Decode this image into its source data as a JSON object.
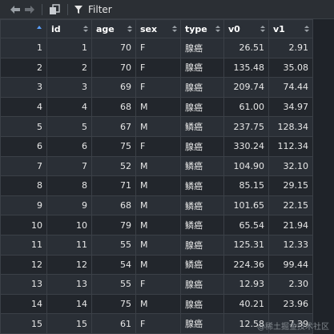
{
  "toolbar": {
    "filter_label": "Filter"
  },
  "columns": [
    {
      "label": ""
    },
    {
      "label": "id"
    },
    {
      "label": "age"
    },
    {
      "label": "sex"
    },
    {
      "label": "type"
    },
    {
      "label": "v0"
    },
    {
      "label": "v1"
    }
  ],
  "rows": [
    {
      "n": "1",
      "id": "1",
      "age": "70",
      "sex": "F",
      "type": "腺癌",
      "v0": "26.51",
      "v1": "2.91"
    },
    {
      "n": "2",
      "id": "2",
      "age": "70",
      "sex": "F",
      "type": "腺癌",
      "v0": "135.48",
      "v1": "35.08"
    },
    {
      "n": "3",
      "id": "3",
      "age": "69",
      "sex": "F",
      "type": "腺癌",
      "v0": "209.74",
      "v1": "74.44"
    },
    {
      "n": "4",
      "id": "4",
      "age": "68",
      "sex": "M",
      "type": "腺癌",
      "v0": "61.00",
      "v1": "34.97"
    },
    {
      "n": "5",
      "id": "5",
      "age": "67",
      "sex": "M",
      "type": "鳞癌",
      "v0": "237.75",
      "v1": "128.34"
    },
    {
      "n": "6",
      "id": "6",
      "age": "75",
      "sex": "F",
      "type": "腺癌",
      "v0": "330.24",
      "v1": "112.34"
    },
    {
      "n": "7",
      "id": "7",
      "age": "52",
      "sex": "M",
      "type": "鳞癌",
      "v0": "104.90",
      "v1": "32.10"
    },
    {
      "n": "8",
      "id": "8",
      "age": "71",
      "sex": "M",
      "type": "鳞癌",
      "v0": "85.15",
      "v1": "29.15"
    },
    {
      "n": "9",
      "id": "9",
      "age": "68",
      "sex": "M",
      "type": "鳞癌",
      "v0": "101.65",
      "v1": "22.15"
    },
    {
      "n": "10",
      "id": "10",
      "age": "79",
      "sex": "M",
      "type": "鳞癌",
      "v0": "65.54",
      "v1": "21.94"
    },
    {
      "n": "11",
      "id": "11",
      "age": "55",
      "sex": "M",
      "type": "腺癌",
      "v0": "125.31",
      "v1": "12.33"
    },
    {
      "n": "12",
      "id": "12",
      "age": "54",
      "sex": "M",
      "type": "鳞癌",
      "v0": "224.36",
      "v1": "99.44"
    },
    {
      "n": "13",
      "id": "13",
      "age": "55",
      "sex": "F",
      "type": "腺癌",
      "v0": "12.93",
      "v1": "2.30"
    },
    {
      "n": "14",
      "id": "14",
      "age": "75",
      "sex": "M",
      "type": "腺癌",
      "v0": "40.21",
      "v1": "23.96"
    },
    {
      "n": "15",
      "id": "15",
      "age": "61",
      "sex": "F",
      "type": "腺癌",
      "v0": "12.58",
      "v1": "7.39"
    }
  ],
  "watermark": "@稀土掘金技术社区",
  "icons": {
    "back": "back-arrow-icon",
    "forward": "forward-arrow-icon",
    "copy": "copy-icon",
    "filter": "funnel-icon",
    "sort": "sort-icon"
  },
  "colors": {
    "background": "#1f2329",
    "header": "#2b3037",
    "row_odd": "#2a2f36",
    "row_even": "#22262c",
    "accent_sort": "#5aa0ff"
  }
}
